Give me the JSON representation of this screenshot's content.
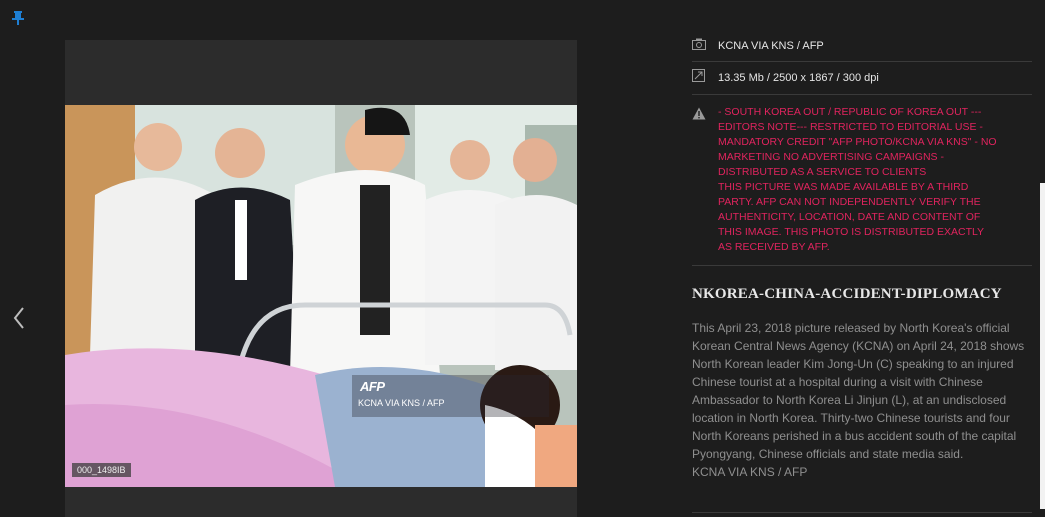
{
  "toolbar": {
    "pin_icon": "pin-icon"
  },
  "nav": {
    "prev_icon": "chevron-left-icon"
  },
  "image": {
    "watermark_logo": "AFP",
    "watermark_credit": "KCNA VIA KNS / AFP",
    "image_id": "000_1498IB"
  },
  "meta": {
    "credit": "KCNA VIA KNS / AFP",
    "size_info": "13.35 Mb / 2500 x 1867 / 300 dpi",
    "restriction": "- SOUTH KOREA OUT / REPUBLIC OF KOREA OUT ---\nEDITORS NOTE--- RESTRICTED TO EDITORIAL USE -\nMANDATORY CREDIT \"AFP PHOTO/KCNA VIA KNS\" - NO\nMARKETING NO ADVERTISING CAMPAIGNS -\nDISTRIBUTED AS A SERVICE TO CLIENTS\nTHIS PICTURE WAS MADE AVAILABLE BY A THIRD\nPARTY. AFP CAN NOT INDEPENDENTLY VERIFY THE\nAUTHENTICITY, LOCATION, DATE AND CONTENT OF\nTHIS IMAGE. THIS PHOTO IS DISTRIBUTED EXACTLY\nAS RECEIVED BY AFP."
  },
  "headline": "NKOREA-CHINA-ACCIDENT-DIPLOMACY",
  "caption": "This April 23, 2018 picture released by North Korea's official Korean Central News Agency (KCNA) on April 24, 2018 shows North Korean leader Kim Jong-Un (C) speaking to an injured Chinese tourist at a hospital during a visit with Chinese Ambassador to North Korea Li Jinjun (L), at an undisclosed location in North Korea. Thirty-two Chinese tourists and four North Koreans perished in a bus accident south of the capital Pyongyang, Chinese officials and state media said.",
  "caption_credit": "KCNA VIA KNS / AFP",
  "colors": {
    "background": "#1d1d1d",
    "warning": "#e0245e",
    "pin": "#1e7fd4"
  }
}
